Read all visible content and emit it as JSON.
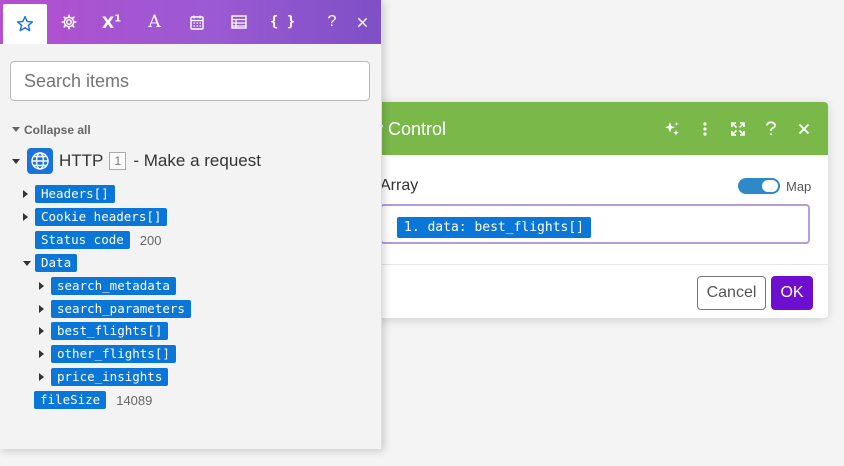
{
  "dialog": {
    "title": "w Control",
    "array_label": "Array",
    "map_label": "Map",
    "array_value": "1. data: best_flights[]",
    "cancel_label": "Cancel",
    "ok_label": "OK"
  },
  "panel": {
    "search_placeholder": "Search items",
    "collapse_label": "Collapse all",
    "module": {
      "name": "HTTP",
      "number": "1",
      "description": "- Make a request"
    },
    "items": {
      "headers": "Headers[]",
      "cookie_headers": "Cookie headers[]",
      "status_code": "Status code",
      "status_code_value": "200",
      "data": "Data",
      "search_metadata": "search_metadata",
      "search_parameters": "search_parameters",
      "best_flights": "best_flights[]",
      "other_flights": "other_flights[]",
      "price_insights": "price_insights",
      "file_size": "fileSize",
      "file_size_value": "14089"
    }
  },
  "colors": {
    "dialog_header": "#7ab84a",
    "chip_blue": "#0a76d8",
    "ok_button": "#6e0fd0",
    "tab_gradient_start": "#b44fcf",
    "tab_gradient_end": "#7e4fc6"
  }
}
